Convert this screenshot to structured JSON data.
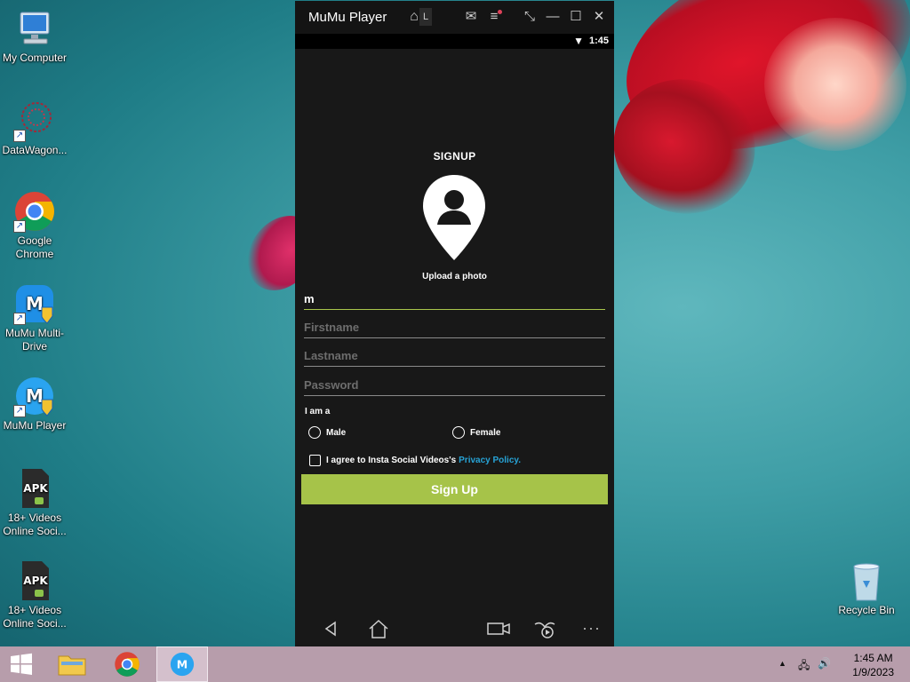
{
  "desktop": {
    "icons": [
      {
        "label": "My Computer",
        "icon": "computer-icon"
      },
      {
        "label": "DataWagon...",
        "icon": "datawagon-icon"
      },
      {
        "label": "Google Chrome",
        "icon": "chrome-icon"
      },
      {
        "label": "MuMu Multi-Drive",
        "icon": "mumu-multidrive-icon"
      },
      {
        "label": "MuMu Player",
        "icon": "mumu-player-icon"
      },
      {
        "label": "18+ Videos Online Soci...",
        "icon": "apk-icon"
      },
      {
        "label": "18+ Videos Online Soci...",
        "icon": "apk-icon"
      },
      {
        "label": "Recycle Bin",
        "icon": "recycle-bin-icon"
      }
    ],
    "apk_text": "APK"
  },
  "window": {
    "title": "MuMu Player",
    "tab_label": "L"
  },
  "statusbar": {
    "time": "1:45"
  },
  "signup": {
    "title": "SIGNUP",
    "upload_label": "Upload a photo",
    "username_value": "m",
    "firstname_placeholder": "Firstname",
    "lastname_placeholder": "Lastname",
    "password_placeholder": "Password",
    "iam_label": "I am a",
    "male_label": "Male",
    "female_label": "Female",
    "agree_text": "I agree to Insta Social Videos's",
    "privacy_link": "Privacy Policy.",
    "button_label": "Sign Up"
  },
  "colors": {
    "accent": "#a6c349",
    "link": "#27a3d6",
    "background": "#181818"
  },
  "taskbar": {
    "time": "1:45 AM",
    "date": "1/9/2023"
  }
}
